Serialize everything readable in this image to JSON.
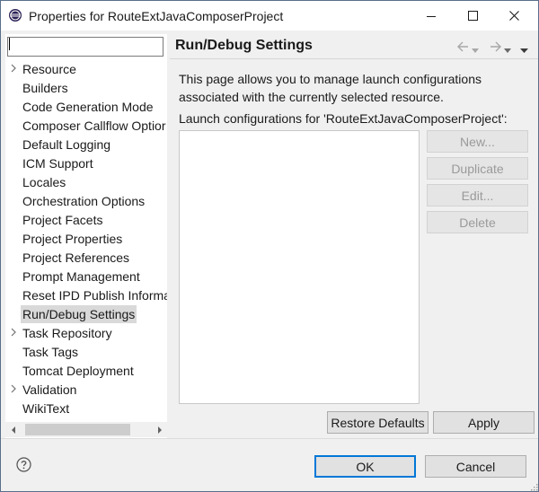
{
  "window": {
    "title": "Properties for RouteExtJavaComposerProject",
    "icons": [
      "eclipse-app-icon",
      "minimize-icon",
      "maximize-icon",
      "close-icon"
    ]
  },
  "filter": {
    "value": "",
    "placeholder": ""
  },
  "tree": {
    "items": [
      {
        "label": "Resource",
        "expandable": true
      },
      {
        "label": "Builders",
        "expandable": false
      },
      {
        "label": "Code Generation Mode",
        "expandable": false
      },
      {
        "label": "Composer Callflow Optior",
        "expandable": false
      },
      {
        "label": "Default Logging",
        "expandable": false
      },
      {
        "label": "ICM Support",
        "expandable": false
      },
      {
        "label": "Locales",
        "expandable": false
      },
      {
        "label": "Orchestration Options",
        "expandable": false
      },
      {
        "label": "Project Facets",
        "expandable": false
      },
      {
        "label": "Project Properties",
        "expandable": false
      },
      {
        "label": "Project References",
        "expandable": false
      },
      {
        "label": "Prompt Management",
        "expandable": false
      },
      {
        "label": "Reset IPD Publish Informa",
        "expandable": false
      },
      {
        "label": "Run/Debug Settings",
        "expandable": false,
        "selected": true
      },
      {
        "label": "Task Repository",
        "expandable": true
      },
      {
        "label": "Task Tags",
        "expandable": false
      },
      {
        "label": "Tomcat Deployment",
        "expandable": false
      },
      {
        "label": "Validation",
        "expandable": true
      },
      {
        "label": "WikiText",
        "expandable": false
      }
    ]
  },
  "page": {
    "title": "Run/Debug Settings",
    "description": "This page allows you to manage launch configurations associated with the currently selected resource.",
    "list_label": "Launch configurations for 'RouteExtJavaComposerProject':",
    "new_label": "New...",
    "duplicate_label": "Duplicate",
    "edit_label": "Edit...",
    "delete_label": "Delete",
    "restore_label": "Restore Defaults",
    "apply_label": "Apply"
  },
  "footer": {
    "ok_label": "OK",
    "cancel_label": "Cancel"
  },
  "colors": {
    "selection": "#d9d9d9",
    "default_button_border": "#0078d7",
    "disabled_text": "#9a9a9a"
  }
}
